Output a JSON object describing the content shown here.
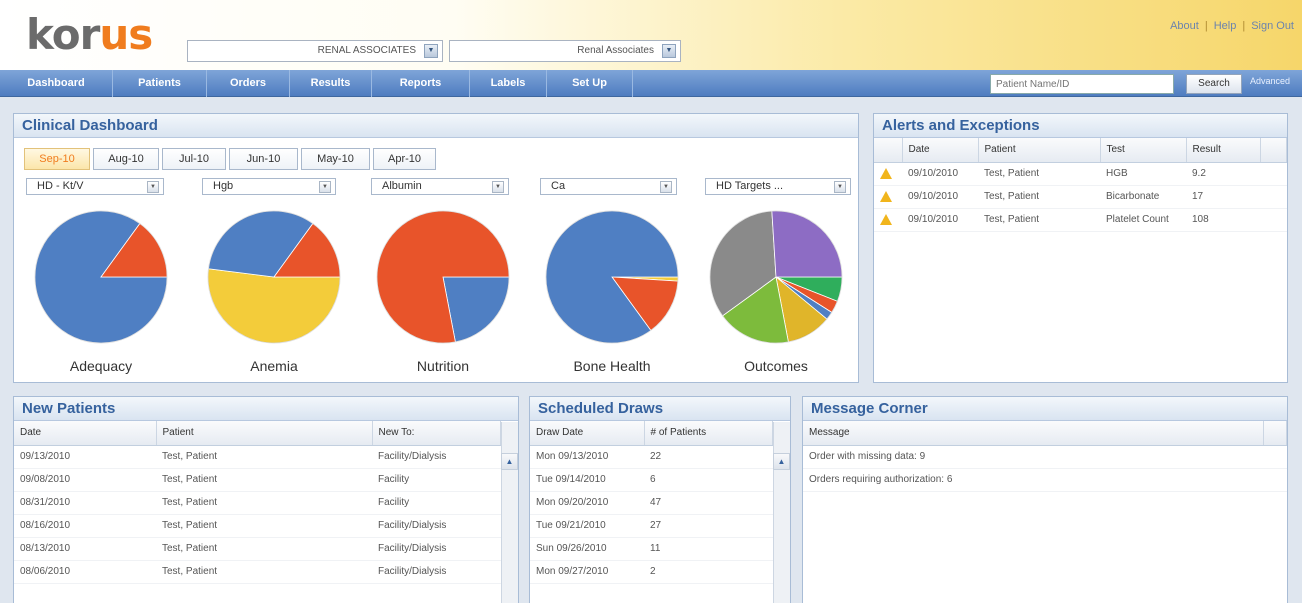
{
  "header": {
    "logo_main": "kor",
    "logo_accent": "us",
    "select_1": "RENAL ASSOCIATES",
    "select_2": "Renal Associates",
    "links": [
      "About",
      "Help",
      "Sign Out"
    ]
  },
  "nav": {
    "items": [
      "Dashboard",
      "Patients",
      "Orders",
      "Results",
      "Reports",
      "Labels",
      "Set Up"
    ],
    "search_placeholder": "Patient Name/ID",
    "search_button": "Search",
    "advanced": "Advanced"
  },
  "clinical": {
    "title": "Clinical Dashboard",
    "months": [
      "Sep-10",
      "Aug-10",
      "Jul-10",
      "Jun-10",
      "May-10",
      "Apr-10"
    ],
    "active_month": "Sep-10",
    "selects": [
      "HD - Kt/V",
      "Hgb",
      "Albumin",
      "Ca",
      "HD Targets ..."
    ],
    "labels": [
      "Adequacy",
      "Anemia",
      "Nutrition",
      "Bone Health",
      "Outcomes"
    ],
    "colors": {
      "blue": "#4f7fc3",
      "orange": "#e8542a",
      "yellow": "#f3cc3a",
      "purple": "#8d6cc4",
      "green": "#2fae5c",
      "gray": "#8a8a8a",
      "lime": "#7dbb3c",
      "gold": "#e0b52a"
    }
  },
  "chart_data": [
    {
      "type": "pie",
      "title": "Adequacy",
      "slices": [
        {
          "label": "",
          "value": 85,
          "color": "#4f7fc3"
        },
        {
          "label": "",
          "value": 15,
          "color": "#e8542a"
        }
      ]
    },
    {
      "type": "pie",
      "title": "Anemia",
      "slices": [
        {
          "label": "",
          "value": 52,
          "color": "#f3cc3a"
        },
        {
          "label": "",
          "value": 33,
          "color": "#4f7fc3"
        },
        {
          "label": "",
          "value": 15,
          "color": "#e8542a"
        }
      ]
    },
    {
      "type": "pie",
      "title": "Nutrition",
      "slices": [
        {
          "label": "",
          "value": 22,
          "color": "#4f7fc3"
        },
        {
          "label": "",
          "value": 78,
          "color": "#e8542a"
        }
      ]
    },
    {
      "type": "pie",
      "title": "Bone Health",
      "slices": [
        {
          "label": "",
          "value": 1,
          "color": "#f3cc3a"
        },
        {
          "label": "",
          "value": 14,
          "color": "#e8542a"
        },
        {
          "label": "",
          "value": 85,
          "color": "#4f7fc3"
        }
      ]
    },
    {
      "type": "pie",
      "title": "Outcomes",
      "slices": [
        {
          "label": "",
          "value": 6,
          "color": "#2fae5c"
        },
        {
          "label": "",
          "value": 3,
          "color": "#e8542a"
        },
        {
          "label": "",
          "value": 2,
          "color": "#4f7fc3"
        },
        {
          "label": "",
          "value": 11,
          "color": "#e0b52a"
        },
        {
          "label": "",
          "value": 18,
          "color": "#7dbb3c"
        },
        {
          "label": "",
          "value": 34,
          "color": "#8a8a8a"
        },
        {
          "label": "",
          "value": 26,
          "color": "#8d6cc4"
        }
      ]
    }
  ],
  "alerts": {
    "title": "Alerts and Exceptions",
    "columns": [
      "Date",
      "Patient",
      "Test",
      "Result"
    ],
    "rows": [
      [
        "09/10/2010",
        "Test, Patient",
        "HGB",
        "9.2"
      ],
      [
        "09/10/2010",
        "Test, Patient",
        "Bicarbonate",
        "17"
      ],
      [
        "09/10/2010",
        "Test, Patient",
        "Platelet Count",
        "108"
      ]
    ]
  },
  "new_patients": {
    "title": "New Patients",
    "columns": [
      "Date",
      "Patient",
      "New To:"
    ],
    "rows": [
      [
        "09/13/2010",
        "Test, Patient",
        "Facility/Dialysis"
      ],
      [
        "09/08/2010",
        "Test, Patient",
        "Facility"
      ],
      [
        "08/31/2010",
        "Test, Patient",
        "Facility"
      ],
      [
        "08/16/2010",
        "Test, Patient",
        "Facility/Dialysis"
      ],
      [
        "08/13/2010",
        "Test, Patient",
        "Facility/Dialysis"
      ],
      [
        "08/06/2010",
        "Test, Patient",
        "Facility/Dialysis"
      ]
    ]
  },
  "draws": {
    "title": "Scheduled Draws",
    "columns": [
      "Draw Date",
      "# of Patients"
    ],
    "rows": [
      [
        "Mon 09/13/2010",
        "22"
      ],
      [
        "Tue 09/14/2010",
        "6"
      ],
      [
        "Mon 09/20/2010",
        "47"
      ],
      [
        "Tue 09/21/2010",
        "27"
      ],
      [
        "Sun 09/26/2010",
        "11"
      ],
      [
        "Mon 09/27/2010",
        "2"
      ]
    ]
  },
  "messages": {
    "title": "Message Corner",
    "column": "Message",
    "rows": [
      "Order with missing data: 9",
      "Orders requiring authorization: 6"
    ]
  }
}
